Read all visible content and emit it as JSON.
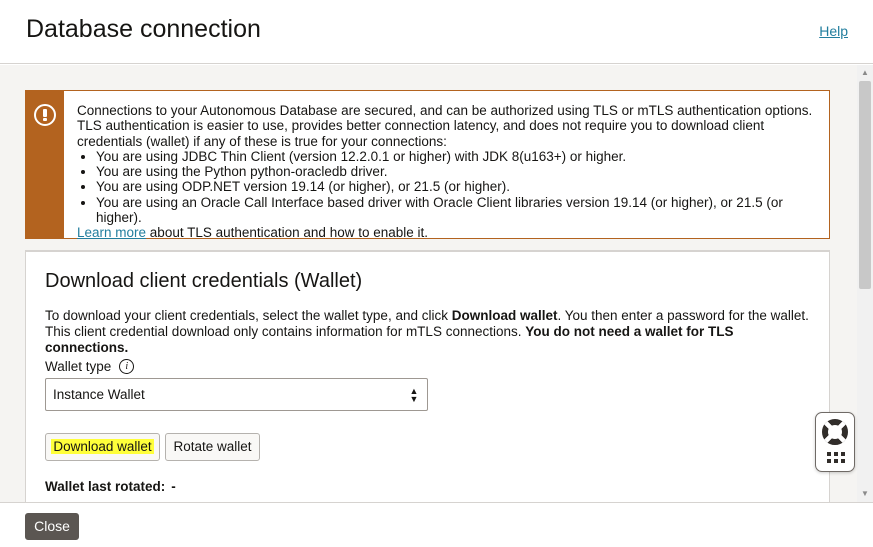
{
  "header": {
    "title": "Database connection",
    "help_label": "Help"
  },
  "alert": {
    "icon": "warning-icon",
    "intro": "Connections to your Autonomous Database are secured, and can be authorized using TLS or mTLS authentication options. TLS authentication is easier to use, provides better connection latency, and does not require you to download client credentials (wallet) if any of these is true for your connections:",
    "bullets": [
      "You are using JDBC Thin Client (version 12.2.0.1 or higher) with JDK 8(u163+) or higher.",
      "You are using the Python python-oracledb driver.",
      "You are using ODP.NET version 19.14 (or higher), or 21.5 (or higher).",
      "You are using an Oracle Call Interface based driver with Oracle Client libraries version 19.14 (or higher), or 21.5 (or higher)."
    ],
    "learn_more_link": "Learn more",
    "learn_more_suffix": " about TLS authentication and how to enable it.",
    "accent_color": "#b3631f"
  },
  "wallet_section": {
    "title": "Download client credentials (Wallet)",
    "desc_part1": "To download your client credentials, select the wallet type, and click ",
    "desc_bold1": "Download wallet",
    "desc_part2": ". You then enter a password for the wallet. This client credential download only contains information for mTLS connections. ",
    "desc_bold2": "You do not need a wallet for TLS connections.",
    "wallet_type_label": "Wallet type",
    "wallet_type_value": "Instance Wallet",
    "download_label": "Download wallet",
    "rotate_label": "Rotate wallet",
    "last_rotated_label": "Wallet last rotated:",
    "last_rotated_value": "-"
  },
  "footer": {
    "close_label": "Close"
  },
  "floating_widget": {
    "help_icon": "lifebuoy-icon",
    "menu_icon": "grid-icon"
  }
}
